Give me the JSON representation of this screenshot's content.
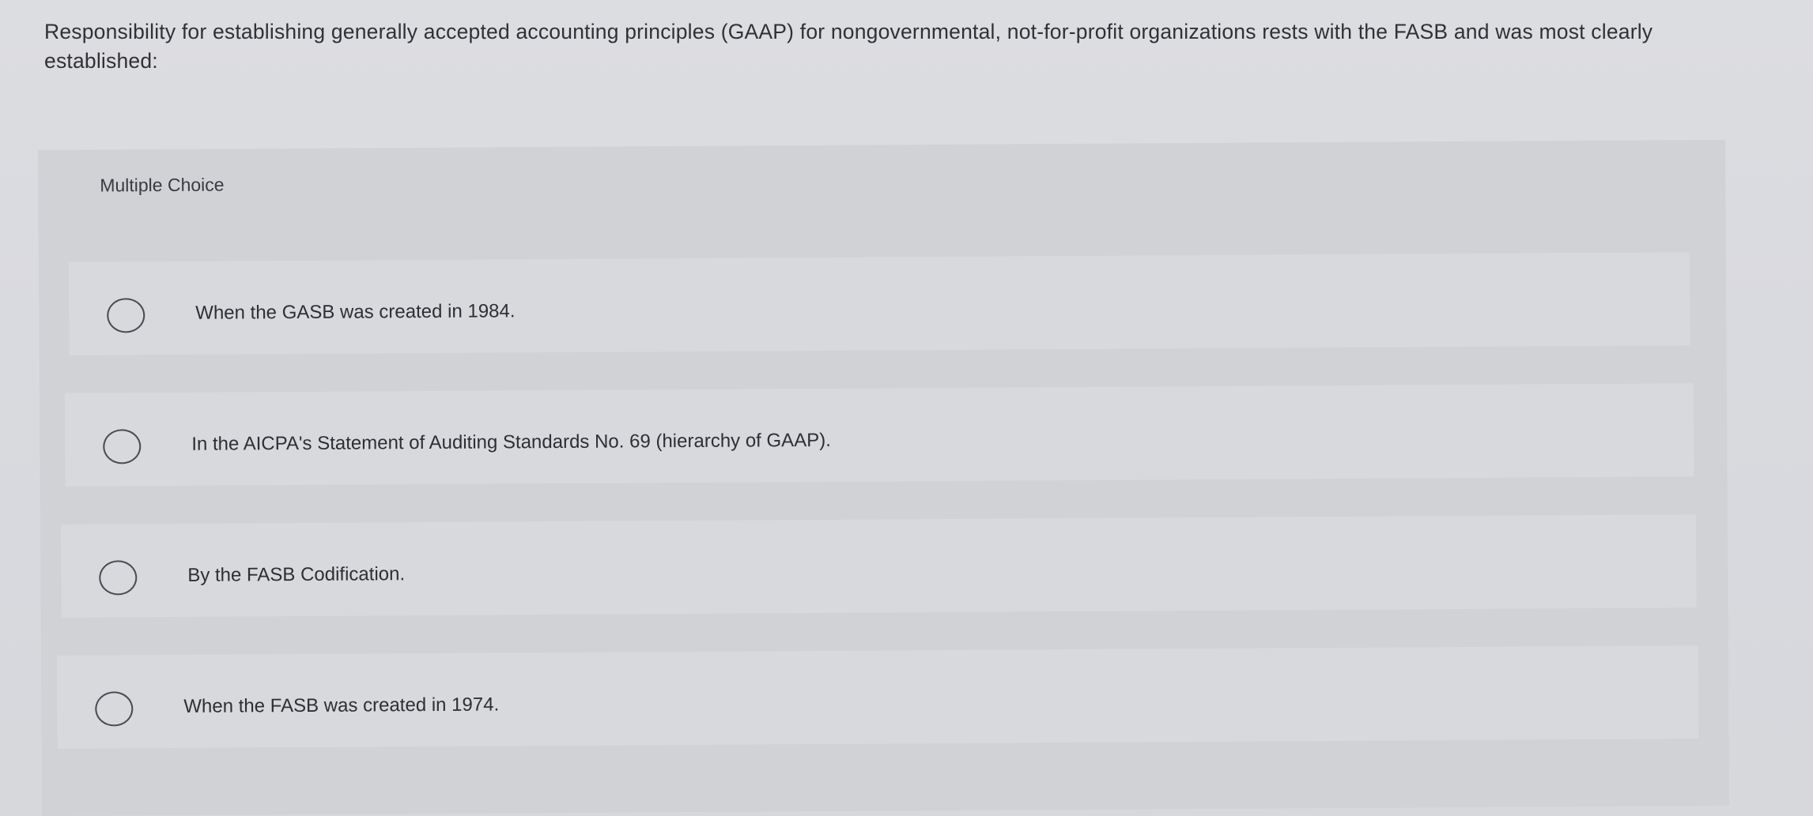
{
  "question": {
    "text": "Responsibility for establishing generally accepted accounting principles (GAAP) for nongovernmental, not-for-profit organizations rests with the FASB and was most clearly established:"
  },
  "mc": {
    "label": "Multiple Choice",
    "options": [
      {
        "label": "When the GASB was created in 1984."
      },
      {
        "label": "In the AICPA's Statement of Auditing Standards No. 69 (hierarchy of GAAP)."
      },
      {
        "label": "By the FASB Codification."
      },
      {
        "label": "When the FASB was created in 1974."
      }
    ],
    "selected": null
  }
}
